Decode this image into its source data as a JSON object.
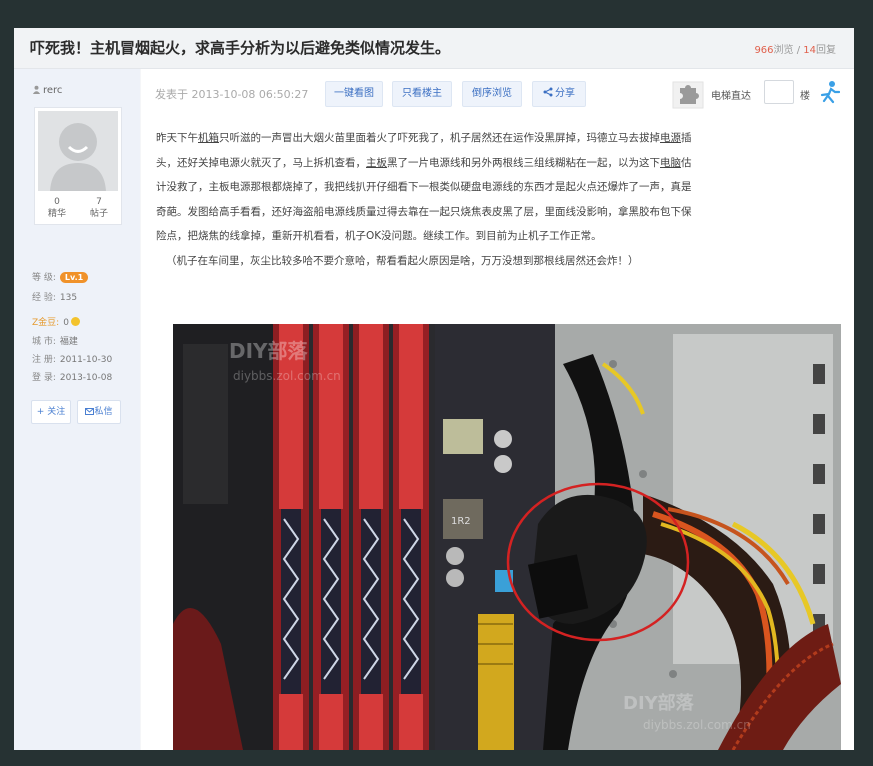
{
  "thread": {
    "title": "吓死我！主机冒烟起火，求高手分析为以后避免类似情况发生。",
    "views": "966",
    "views_label": "浏览",
    "replies": "14",
    "replies_label": "回复"
  },
  "author": {
    "name": "rerc",
    "essence_count": "0",
    "essence_label": "精华",
    "posts_count": "7",
    "posts_label": "帖子",
    "level_key": "等 级:",
    "level": "Lv.1",
    "exp_key": "经 验:",
    "exp": "135",
    "gold_key": "Z金豆:",
    "gold": "0",
    "city_key": "城 市:",
    "city": "福建",
    "reg_key": "注 册:",
    "reg_date": "2011-10-30",
    "login_key": "登 录:",
    "login_date": "2013-10-08",
    "follow_label": "+ 关注",
    "message_label": "私信"
  },
  "post": {
    "time": "发表于 2013-10-08 06:50:27",
    "toolbar": {
      "view_all": "一键看图",
      "only_author": "只看楼主",
      "reverse": "倒序浏览",
      "share": "分享"
    },
    "jump_label": "电梯直达",
    "floor_label": "楼",
    "body": {
      "s1": "昨天下午",
      "u1": "机箱",
      "s2": "只听滋的一声冒出大烟火苗里面着火了吓死我了，机子居然还在运作没黑屏掉，玛德立马去拔掉",
      "u2": "电源",
      "s3": "插头，还好关掉电源火就灭了，马上拆机查看，",
      "u3": "主板",
      "s4": "黑了一片电源线和另外两根线三组线糊粘在一起，以为这下",
      "u4": "电脑",
      "s5": "估计没救了，主板电源那根都烧掉了，我把线扒开仔细看下一根类似硬盘电源线的东西才是起火点还爆炸了一声，真是奇葩。发图给高手看看，还好海盗船电源线质量过得去靠在一起只烧焦表皮黑了层，里面线没影响，拿黑胶布包下保险点，把烧焦的线拿掉，重新开机看看，机子OK没问题。继续工作。到目前为止机子工作正常。",
      "note": "（机子在车间里，灰尘比较多哈不要介意哈，帮看看起火原因是啥，万万没想到那根线居然还会炸！）"
    },
    "photo": {
      "watermark_brand": "DIY部落",
      "watermark_url": "diybbs.zol.com.cn",
      "chip_label": "1R2"
    }
  },
  "colors": {
    "background": "#263233",
    "accent_blue": "#3b6fc2",
    "level_orange": "#f0922a",
    "stat_red": "#e0604c"
  },
  "icons": [
    "user-icon",
    "share-icon",
    "puzzle-icon",
    "elevator-go-icon",
    "envelope-icon",
    "coin-icon"
  ]
}
